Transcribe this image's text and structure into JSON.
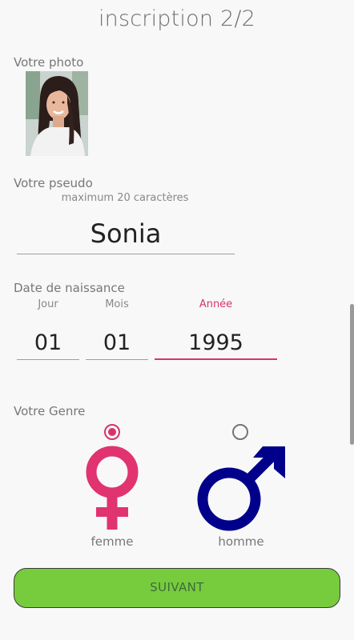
{
  "page": {
    "title": "inscription 2/2"
  },
  "photo": {
    "label": "Votre photo"
  },
  "pseudo": {
    "label": "Votre pseudo",
    "hint": "maximum 20 caractères",
    "value": "Sonia"
  },
  "birthdate": {
    "label": "Date de naissance",
    "day": {
      "label": "Jour",
      "value": "01"
    },
    "month": {
      "label": "Mois",
      "value": "01"
    },
    "year": {
      "label": "Année",
      "value": "1995"
    }
  },
  "gender": {
    "label": "Votre Genre",
    "options": [
      {
        "label": "femme",
        "icon": "female-symbol-icon",
        "selected": true
      },
      {
        "label": "homme",
        "icon": "male-symbol-icon",
        "selected": false
      }
    ]
  },
  "actions": {
    "next_label": "SUIVANT"
  },
  "colors": {
    "accent": "#d6346a",
    "female": "#e0336f",
    "male": "#00008b",
    "button": "#77cc3e"
  }
}
